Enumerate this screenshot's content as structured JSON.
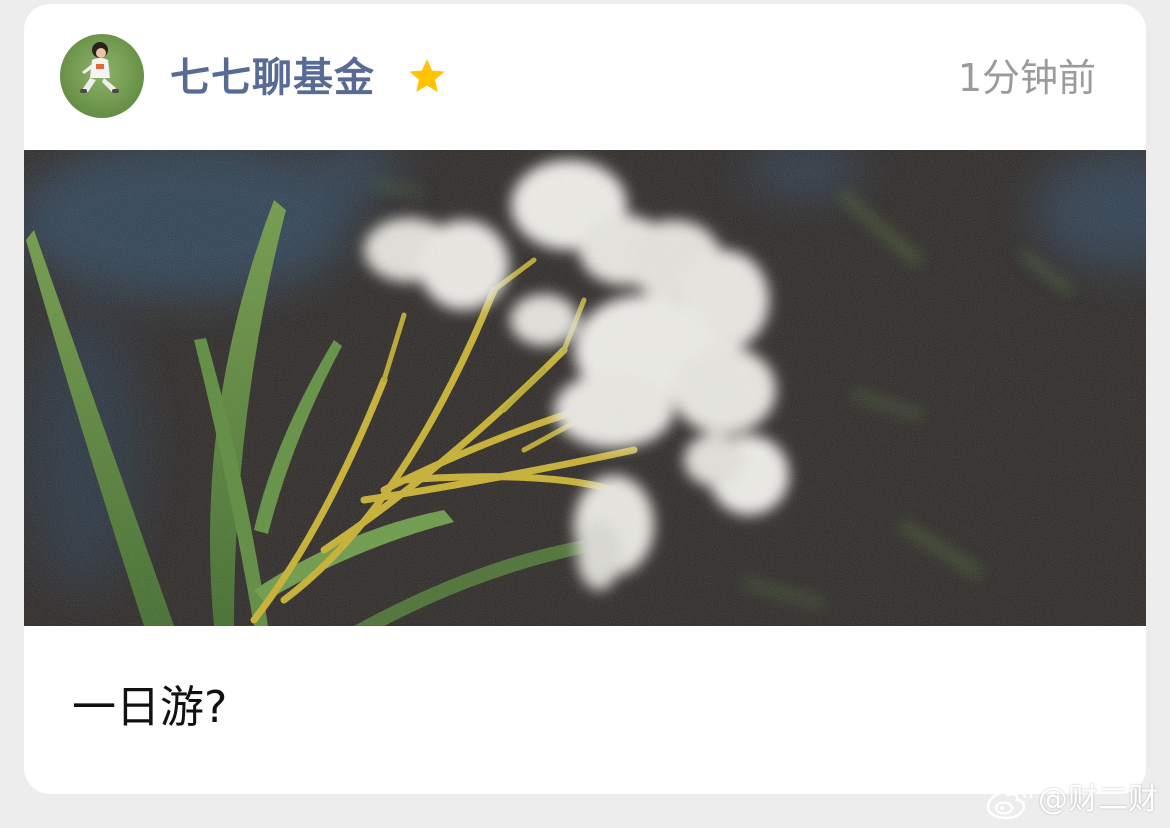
{
  "post": {
    "author": "七七聊基金",
    "timestamp": "1分钟前",
    "text": "一日游?",
    "image_alt": "night photo of white oleander flowers"
  },
  "watermark": {
    "text": "@财二财"
  },
  "icons": {
    "star": "star-icon",
    "weibo": "weibo-logo-icon"
  },
  "colors": {
    "page_background": "#ededed",
    "card_background": "#ffffff",
    "author_name": "#576b95",
    "star": "#ffc300",
    "timestamp": "#9b9b9b",
    "post_text": "#111111"
  }
}
